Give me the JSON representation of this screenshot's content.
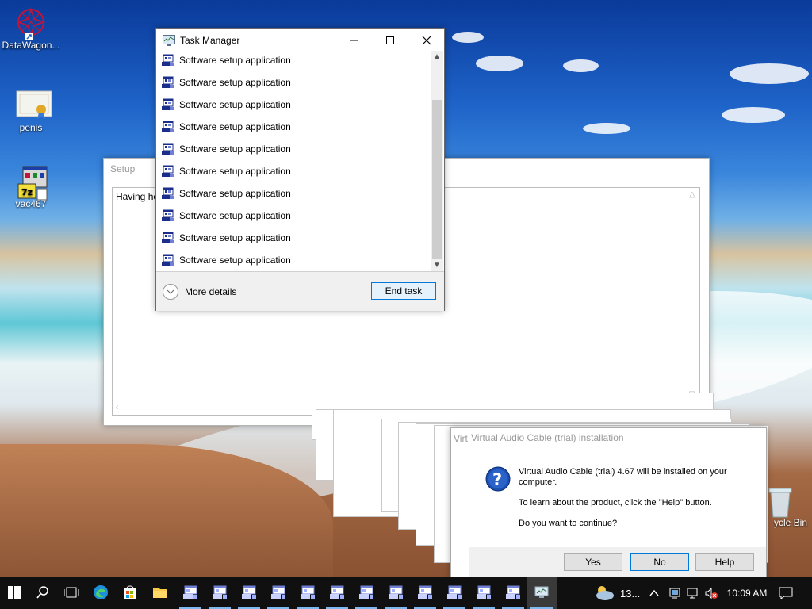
{
  "desktop": {
    "icons": [
      {
        "label": "DataWagon..."
      },
      {
        "label": "penis"
      },
      {
        "label": "vac467"
      },
      {
        "label": "ycle Bin"
      }
    ]
  },
  "task_manager": {
    "title": "Task Manager",
    "rows": [
      "Software setup application",
      "Software setup application",
      "Software setup application",
      "Software setup application",
      "Software setup application",
      "Software setup application",
      "Software setup application",
      "Software setup application",
      "Software setup application",
      "Software setup application"
    ],
    "more_details": "More details",
    "end_task": "End task"
  },
  "setup_window": {
    "title": "Setup",
    "body_text": "Having hel"
  },
  "vac_dialog": {
    "title": "Virtual Audio Cable (trial) installation",
    "title_behind": "Virt",
    "line1": "Virtual Audio Cable (trial) 4.67 will be installed on your computer.",
    "line2": "To learn about the product, click the \"Help\" button.",
    "line3": "Do you want to continue?",
    "yes": "Yes",
    "no": "No",
    "help": "Help"
  },
  "taskbar": {
    "weather": "13...",
    "clock": "10:09 AM",
    "setup_items_count": 12
  }
}
